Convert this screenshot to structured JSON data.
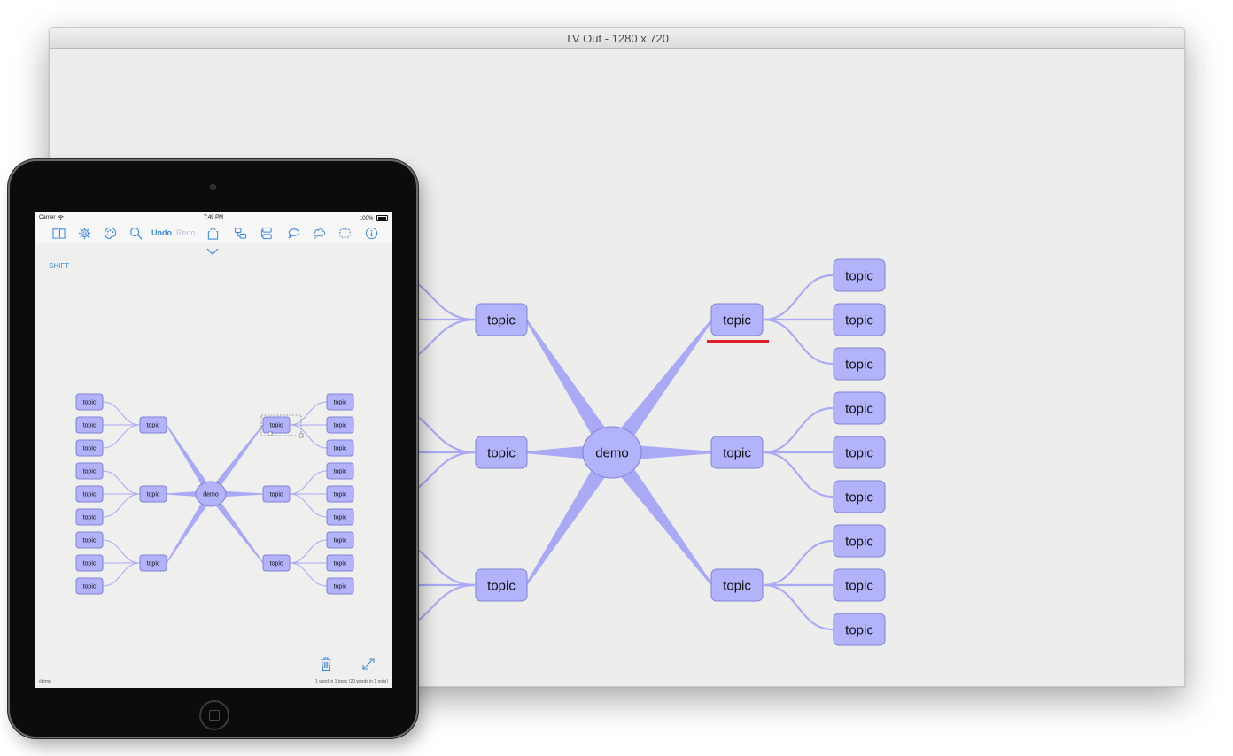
{
  "tv_window": {
    "title": "TV Out - 1280 x 720",
    "central_label": "demo",
    "branch_label": "topic",
    "selection_color": "#e0202a"
  },
  "ipad": {
    "status": {
      "carrier": "Carrier",
      "wifi_icon": "wifi-icon",
      "time": "7:49 PM",
      "battery": "100%"
    },
    "toolbar": {
      "undo_label": "Undo",
      "redo_label": "Redo",
      "icons": [
        "book-icon",
        "gear-icon",
        "palette-icon",
        "search-icon",
        "share-icon",
        "add-child-icon",
        "add-sibling-icon",
        "callout-icon",
        "cloud-callout-icon",
        "boundary-icon",
        "info-icon"
      ]
    },
    "shift_label": "SHIFT",
    "central_label": "demo",
    "branch_label": "topic",
    "bottom_left": "/demo",
    "bottom_right": "1 word in 1 topic (20 words in 1 note)"
  },
  "colors": {
    "node_fill": "#b3b3fb",
    "node_stroke": "#8080d8",
    "branch": "#a9a9f6",
    "accent": "#3a87e0"
  }
}
